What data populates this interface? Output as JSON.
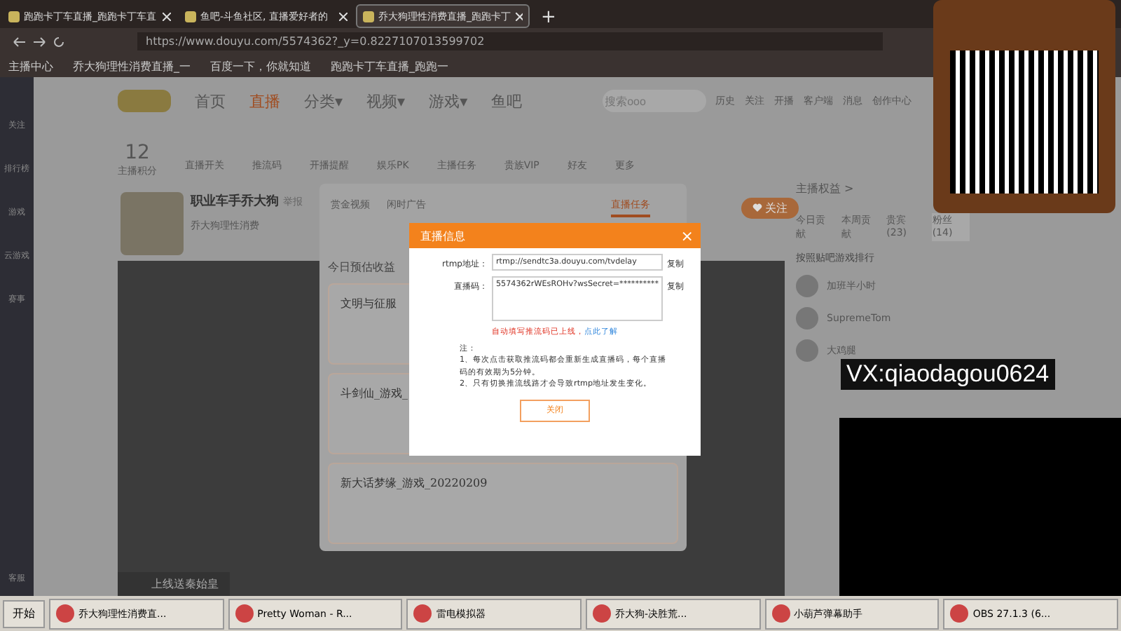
{
  "browser": {
    "tabs": [
      {
        "title": "跑跑卡丁车直播_跑跑卡丁车直",
        "selected": false
      },
      {
        "title": "鱼吧-斗鱼社区, 直播爱好者的",
        "selected": false
      },
      {
        "title": "乔大狗理性消费直播_跑跑卡丁",
        "selected": true
      }
    ],
    "new_tab": "+",
    "url": "https://www.douyu.com/5574362?_y=0.8227107013599702",
    "bookmarks": [
      "主播中心",
      "乔大狗理性消费直播_一",
      "百度一下，你就知道",
      "跑跑卡丁车直播_跑跑一"
    ]
  },
  "sidebar": {
    "items": [
      "关注",
      "排行榜",
      "游戏",
      "云游戏",
      "赛事"
    ],
    "bottom_item": "客服"
  },
  "header": {
    "nav": [
      {
        "label": "首页",
        "selected": false
      },
      {
        "label": "直播",
        "selected": true
      },
      {
        "label": "分类▾",
        "selected": false
      },
      {
        "label": "视频▾",
        "selected": false
      },
      {
        "label": "游戏▾",
        "selected": false
      },
      {
        "label": "鱼吧",
        "selected": false
      }
    ],
    "search": {
      "placeholder": "搜索ooo"
    },
    "actions": [
      "历史",
      "关注",
      "开播",
      "客户端",
      "消息",
      "创作中心"
    ]
  },
  "tools": {
    "score": "12",
    "score_label": "主播积分",
    "items": [
      "直播开关",
      "推流码",
      "开播提醒",
      "娱乐PK",
      "主播任务",
      "贵族VIP",
      "好友",
      "更多"
    ]
  },
  "streamer": {
    "name": "职业车手乔大狗",
    "report": "举报",
    "room_name": "乔大狗理性消费",
    "follow": "关注"
  },
  "task_panel": {
    "tabs": [
      {
        "label": "赏金视频",
        "selected": false
      },
      {
        "label": "闲时广告",
        "selected": false
      },
      {
        "label": "直播任务",
        "selected": true
      }
    ],
    "income_label": "今日预估收益",
    "tasks": [
      {
        "title": "文明与征服"
      },
      {
        "title": "斗剑仙_游戏_"
      },
      {
        "title": "新大话梦缘_游戏_20220209"
      }
    ]
  },
  "dialog": {
    "title": "直播信息",
    "close": "×",
    "rtmp_label": "rtmp地址：",
    "rtmp_value": "rtmp://sendtc3a.douyu.com/tvdelay",
    "copy_1": "复制",
    "code_label": "直播码：",
    "code_value": "5574362rWEsROHv?wsSecret=**********",
    "copy_2": "复制",
    "notice": "自动填写推流码已上线，",
    "notice_link": "点此了解",
    "note_title": "注：",
    "notes": [
      "1、每次点击获取推流码都会重新生成直播码，每个直播码的有效期为5分钟。",
      "2、只有切换推流线路才会导致rtmp地址发生变化。"
    ],
    "close_button": "关闭"
  },
  "right_panel": {
    "header": "主播权益 >",
    "tabs": [
      {
        "label": "今日贡献",
        "selected": false
      },
      {
        "label": "本周贡献",
        "selected": false
      },
      {
        "label": "贵宾(23)",
        "selected": false
      },
      {
        "label": "粉丝(14)",
        "selected": true
      }
    ],
    "rank_title": "按照贴吧游戏排行",
    "fans": [
      "加班半小时",
      "SupremeTom",
      "大鸡腿"
    ]
  },
  "overlays": {
    "wechat": "VX:qiaodagou0624"
  },
  "banner": "上线送秦始皇",
  "taskbar": {
    "start": "开始",
    "items": [
      "乔大狗理性消费直...",
      "Pretty Woman - R...",
      "雷电模拟器",
      "乔大狗-决胜荒...",
      "小葫芦弹幕助手",
      "OBS 27.1.3 (6..."
    ]
  }
}
